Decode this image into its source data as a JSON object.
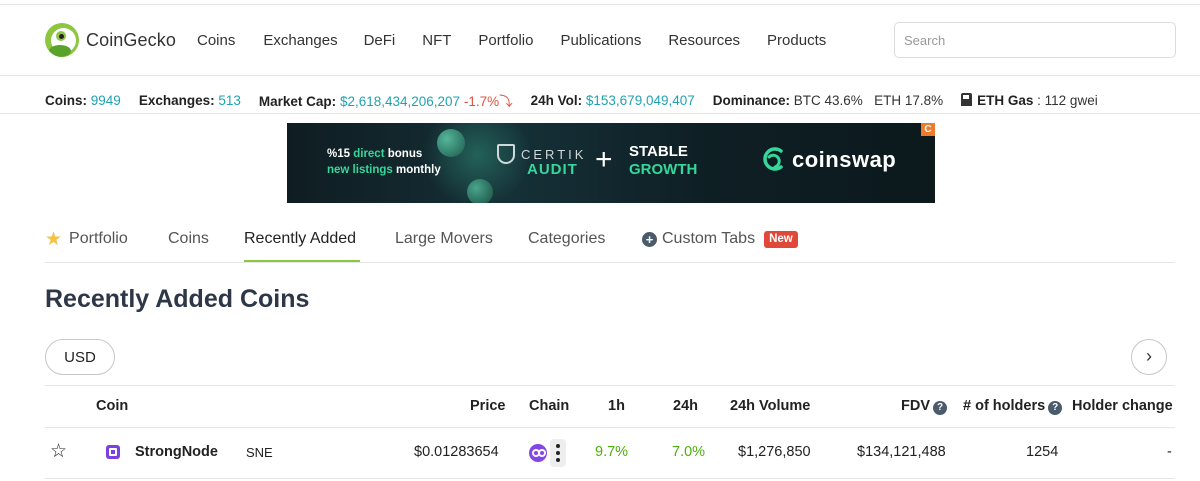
{
  "header": {
    "logo_text": "CoinGecko",
    "nav": [
      "Coins",
      "Exchanges",
      "DeFi",
      "NFT",
      "Portfolio",
      "Publications",
      "Resources",
      "Products"
    ],
    "search_placeholder": "Search"
  },
  "stats": {
    "coins_label": "Coins:",
    "coins_value": "9949",
    "exchanges_label": "Exchanges:",
    "exchanges_value": "513",
    "market_cap_label": "Market Cap:",
    "market_cap_value": "$2,618,434,206,207",
    "market_cap_change": "-1.7%",
    "market_cap_arrow": "⤵",
    "volume_label": "24h Vol:",
    "volume_value": "$153,679,049,407",
    "dominance_label": "Dominance:",
    "dominance_btc": "BTC 43.6%",
    "dominance_eth": "ETH 17.8%",
    "gas_label": "ETH Gas",
    "gas_value": ": 112 gwei",
    "accent_color": "#22a2b0",
    "negative_color": "#e15241"
  },
  "banner": {
    "line1_a": "%15 ",
    "line1_b": "direct",
    "line1_c": " bonus",
    "line2_a": "new listings",
    "line2_b": " monthly",
    "certik": "CERTIK",
    "audit": "AUDIT",
    "plus": "+",
    "stable": "STABLE",
    "growth": "GROWTH",
    "brand": "coinswap",
    "ad_tag": "C"
  },
  "tabs": {
    "portfolio": "Portfolio",
    "coins": "Coins",
    "recently_added": "Recently Added",
    "large_movers": "Large Movers",
    "categories": "Categories",
    "custom_tabs": "Custom Tabs",
    "new_badge": "New",
    "active_color": "#8dc63f"
  },
  "page_title": "Recently Added Coins",
  "currency": "USD",
  "next": "›",
  "table": {
    "columns": {
      "coin": "Coin",
      "price": "Price",
      "chain": "Chain",
      "h1": "1h",
      "h24": "24h",
      "volume": "24h Volume",
      "fdv": "FDV",
      "holders": "# of holders",
      "holder_change": "Holder change"
    },
    "help_glyph": "?",
    "rows": [
      {
        "name": "StrongNode",
        "symbol": "SNE",
        "price": "$0.01283654",
        "change_1h": "9.7%",
        "change_24h": "7.0%",
        "volume_24h": "$1,276,850",
        "fdv": "$134,121,488",
        "holders": "1254",
        "holder_change": "-"
      }
    ],
    "positive_color": "#4eaf0a"
  },
  "icons": {
    "star_filled": "★",
    "star_outline": "☆",
    "plus_circle": "+"
  }
}
